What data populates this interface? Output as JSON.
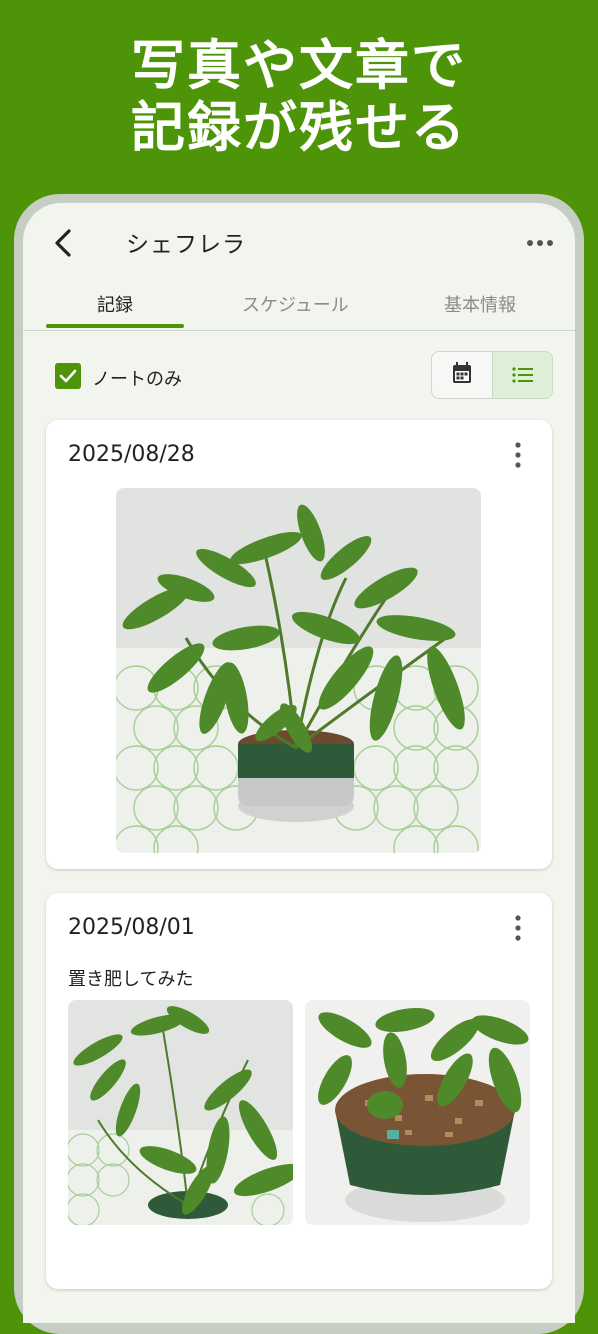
{
  "hero": {
    "line1": "写真や文章で",
    "line2": "記録が残せる"
  },
  "appbar": {
    "title": "シェフレラ",
    "back_icon": "chevron-left-icon",
    "menu_icon": "more-horizontal-icon"
  },
  "tabs": [
    {
      "label": "記録",
      "active": true
    },
    {
      "label": "スケジュール",
      "active": false
    },
    {
      "label": "基本情報",
      "active": false
    }
  ],
  "filter": {
    "label": "ノートのみ",
    "checked": true
  },
  "view_toggle": {
    "calendar_icon": "calendar-icon",
    "list_icon": "list-icon",
    "selected": "list"
  },
  "records": [
    {
      "date": "2025/08/28",
      "note": "",
      "photos": 1
    },
    {
      "date": "2025/08/01",
      "note": "置き肥してみた",
      "photos": 2
    }
  ],
  "colors": {
    "brand": "#4d9408",
    "screen_bg": "#f2f5ee",
    "selected_toggle_bg": "#deefd7"
  }
}
